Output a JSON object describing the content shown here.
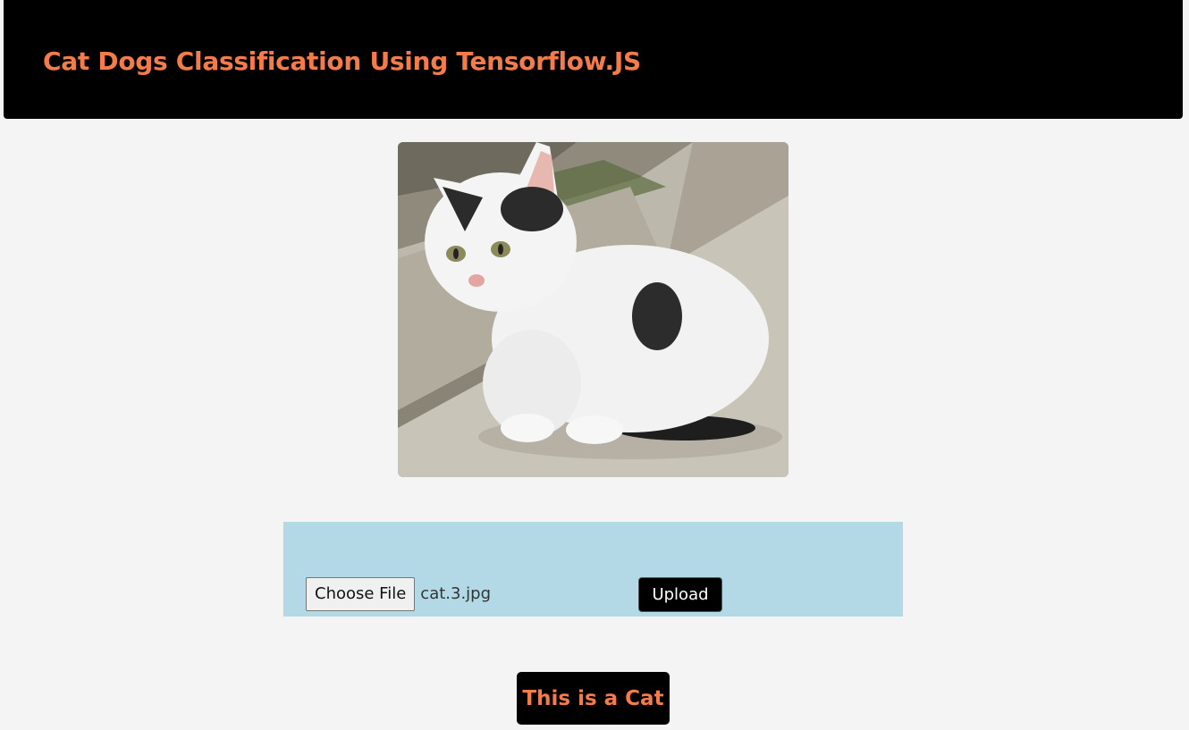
{
  "header": {
    "title": "Cat Dogs Classification Using Tensorflow.JS"
  },
  "preview": {
    "image_name": "cat-photo"
  },
  "upload": {
    "choose_label": "Choose File",
    "file_name": "cat.3.jpg",
    "upload_label": "Upload"
  },
  "result": {
    "text": "This is a Cat"
  },
  "colors": {
    "accent": "#f47c4a",
    "header_bg": "#000000",
    "panel_bg": "#b3d9e6",
    "page_bg": "#f4f4f4"
  }
}
